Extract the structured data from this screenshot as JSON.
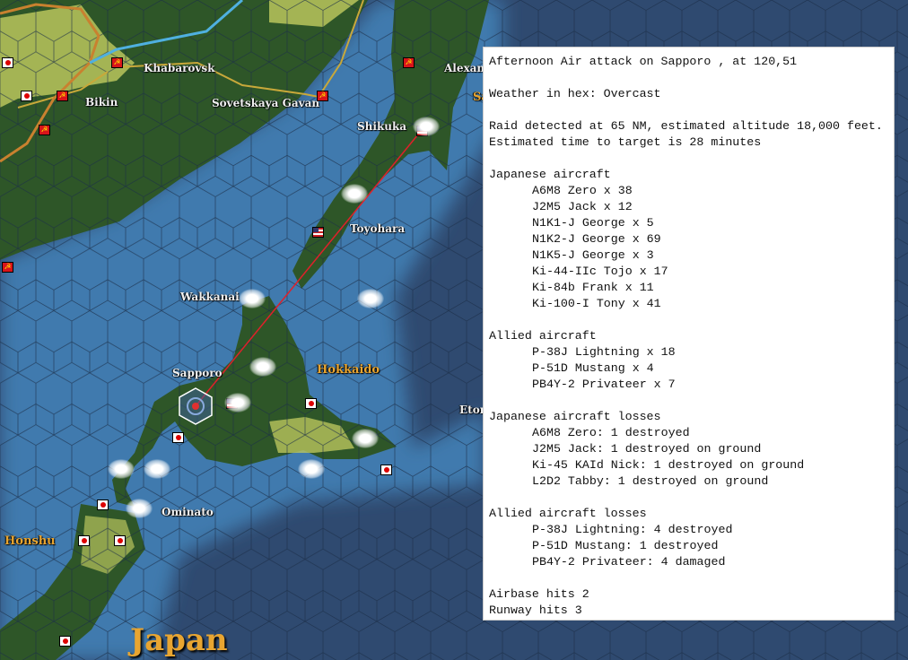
{
  "map": {
    "labels": {
      "khabarovsk": "Khabarovsk",
      "bikin": "Bikin",
      "sovetskaya_gavan": "Sovetskaya Gavan",
      "alexand": "Alexand",
      "sa": "Sa",
      "shikuka": "Shikuka",
      "toyohara": "Toyohara",
      "wakkanai": "Wakkanai",
      "sapporo": "Sapporo",
      "hokkaido": "Hokkaido",
      "etor": "Etor",
      "ominato": "Ominato",
      "honshu": "Honshu",
      "japan": "Japan"
    },
    "colors": {
      "deep_sea": "#2f4a70",
      "shallow_sea": "#3f7aae",
      "land": "#2e5628",
      "steppe": "#c9cf6a",
      "attack_line": "#e0202a"
    }
  },
  "report": {
    "title": "Afternoon Air attack on Sapporo , at 120,51",
    "weather": "Weather in hex: Overcast",
    "raid_detected": "Raid detected at 65 NM, estimated altitude 18,000 feet.",
    "time_to_target": "Estimated time to target is 28 minutes",
    "japanese_aircraft_header": "Japanese aircraft",
    "japanese_aircraft": [
      "A6M8 Zero x 38",
      "J2M5 Jack x 12",
      "N1K1-J George x 5",
      "N1K2-J George x 69",
      "N1K5-J George x 3",
      "Ki-44-IIc Tojo x 17",
      "Ki-84b Frank x 11",
      "Ki-100-I Tony x 41"
    ],
    "allied_aircraft_header": "Allied aircraft",
    "allied_aircraft": [
      "P-38J Lightning x 18",
      "P-51D Mustang x 4",
      "PB4Y-2 Privateer x 7"
    ],
    "japanese_losses_header": "Japanese aircraft losses",
    "japanese_losses": [
      "A6M8 Zero: 1 destroyed",
      "J2M5 Jack: 1 destroyed on ground",
      "Ki-45 KAId Nick: 1 destroyed on ground",
      "L2D2 Tabby: 1 destroyed on ground"
    ],
    "allied_losses_header": "Allied aircraft losses",
    "allied_losses": [
      "P-38J Lightning: 4 destroyed",
      "P-51D Mustang: 1 destroyed",
      "PB4Y-2 Privateer: 4 damaged"
    ],
    "airbase_hits": "Airbase hits 2",
    "runway_hits": "Runway hits 3"
  }
}
